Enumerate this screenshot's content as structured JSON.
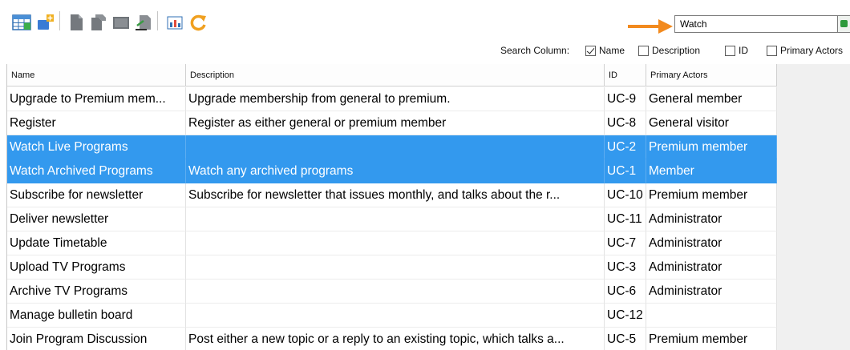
{
  "toolbar": {
    "icons": [
      "table-grid-icon",
      "add-item-icon",
      "document-icon",
      "document-copy-icon",
      "image-document-icon",
      "export-icon",
      "chart-icon",
      "refresh-icon"
    ]
  },
  "search": {
    "value": "Watch"
  },
  "search_columns": {
    "label": "Search Column:",
    "options": [
      {
        "label": "Name",
        "checked": true
      },
      {
        "label": "Description",
        "checked": false
      },
      {
        "label": "ID",
        "checked": false
      },
      {
        "label": "Primary Actors",
        "checked": false
      }
    ]
  },
  "table": {
    "columns": [
      "Name",
      "Description",
      "ID",
      "Primary Actors"
    ],
    "rows": [
      {
        "name": "Upgrade to Premium mem...",
        "description": "Upgrade membership from general to premium.",
        "id": "UC-9",
        "actors": "General member",
        "selected": false
      },
      {
        "name": "Register",
        "description": "Register as either general or premium member",
        "id": "UC-8",
        "actors": "General visitor",
        "selected": false
      },
      {
        "name": "Watch Live Programs",
        "description": "",
        "id": "UC-2",
        "actors": "Premium member",
        "selected": true
      },
      {
        "name": "Watch Archived Programs",
        "description": "Watch any archived programs",
        "id": "UC-1",
        "actors": "Member",
        "selected": true
      },
      {
        "name": "Subscribe for newsletter",
        "description": "Subscribe for newsletter that issues monthly, and talks about the r...",
        "id": "UC-10",
        "actors": "Premium member",
        "selected": false
      },
      {
        "name": "Deliver newsletter",
        "description": "",
        "id": "UC-11",
        "actors": "Administrator",
        "selected": false
      },
      {
        "name": "Update Timetable",
        "description": "",
        "id": "UC-7",
        "actors": "Administrator",
        "selected": false
      },
      {
        "name": "Upload TV Programs",
        "description": "",
        "id": "UC-3",
        "actors": "Administrator",
        "selected": false
      },
      {
        "name": "Archive TV Programs",
        "description": "",
        "id": "UC-6",
        "actors": "Administrator",
        "selected": false
      },
      {
        "name": "Manage bulletin board",
        "description": "",
        "id": "UC-12",
        "actors": "",
        "selected": false
      },
      {
        "name": "Join Program Discussion",
        "description": "Post either a new topic or a reply to an existing topic, which talks a...",
        "id": "UC-5",
        "actors": "Premium member",
        "selected": false
      }
    ]
  },
  "colors": {
    "selection": "#3399ee",
    "arrow": "#f28a1e",
    "icon_blue": "#4a7fc0",
    "icon_grey": "#6e7378",
    "icon_orange": "#f0a020"
  }
}
